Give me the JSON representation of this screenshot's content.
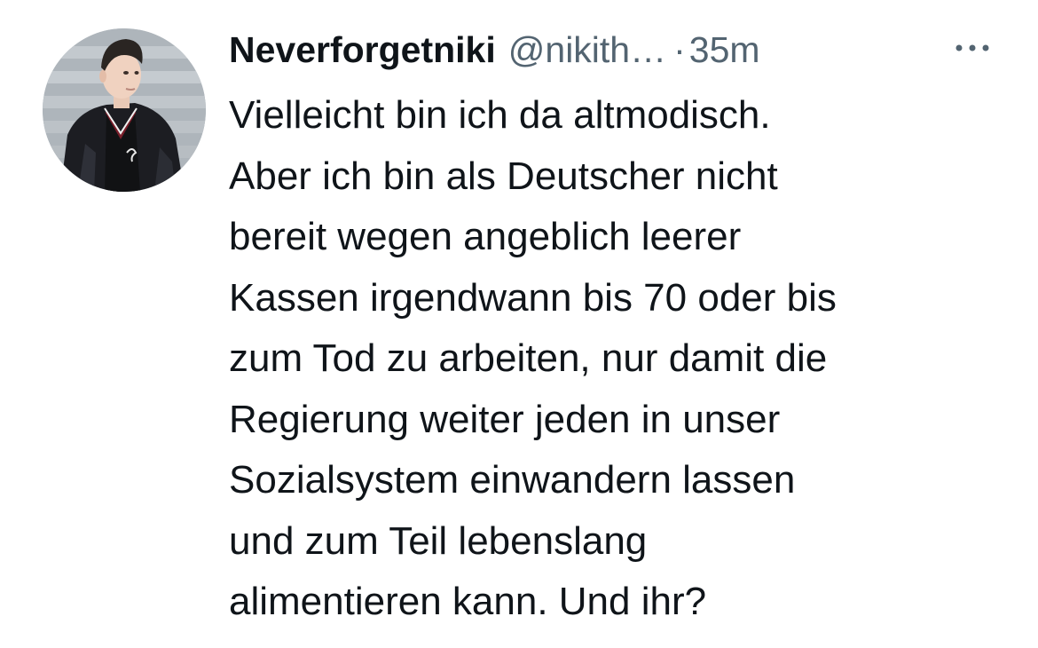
{
  "tweet": {
    "author": {
      "display_name": "Neverforgetniki",
      "handle": "@nikith…",
      "avatar_icon": "user-avatar-photo"
    },
    "separator": "·",
    "timestamp": "35m",
    "more_icon": "more-horizontal-icon",
    "text_lines": [
      "Vielleicht bin ich da altmodisch.",
      "Aber ich bin als Deutscher nicht",
      "bereit wegen angeblich leerer",
      "Kassen irgendwann bis 70 oder bis",
      "zum Tod zu arbeiten, nur damit die",
      "Regierung weiter jeden in unser",
      "Sozialsystem einwandern lassen",
      "und zum Teil lebenslang",
      "alimentieren kann. Und ihr?"
    ],
    "colors": {
      "text_primary": "#0f1419",
      "text_secondary": "#536471"
    }
  }
}
